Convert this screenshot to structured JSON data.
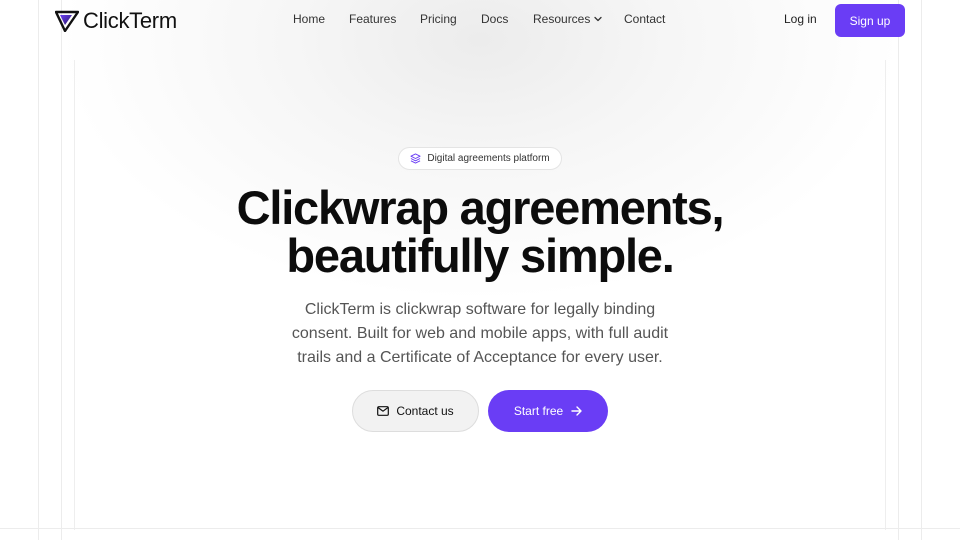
{
  "brand": {
    "name": "ClickTerm",
    "accent": "#6a3df5"
  },
  "nav": {
    "items": [
      {
        "label": "Home"
      },
      {
        "label": "Features"
      },
      {
        "label": "Pricing"
      },
      {
        "label": "Docs"
      },
      {
        "label": "Resources",
        "icon": "chevron-down-icon"
      },
      {
        "label": "Contact"
      }
    ],
    "login_label": "Log in",
    "signup_label": "Sign up"
  },
  "hero": {
    "badge": {
      "icon": "layers-icon",
      "label": "Digital agreements platform"
    },
    "title_line1": "Clickwrap agreements,",
    "title_line2": "beautifully simple.",
    "subtitle_line1": "ClickTerm is clickwrap software for legally binding",
    "subtitle_line2": "consent. Built for web and mobile apps, with full audit",
    "subtitle_line3": "trails and a Certificate of Acceptance for every user.",
    "contact_button": {
      "icon": "mail-icon",
      "label": "Contact us"
    },
    "start_button": {
      "icon": "arrow-right-icon",
      "label": "Start free"
    }
  }
}
